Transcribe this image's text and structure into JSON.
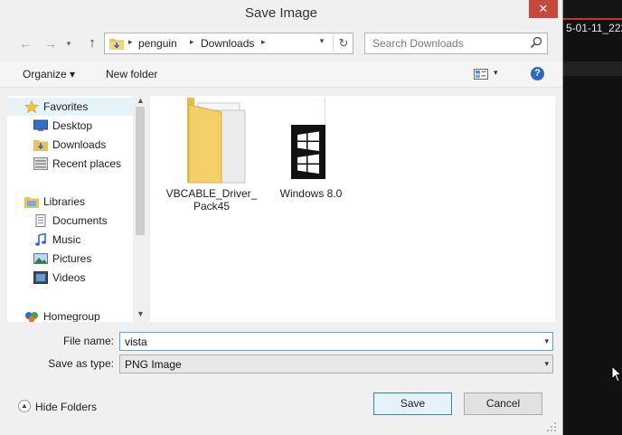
{
  "window": {
    "title": "Save Image",
    "close_glyph": "✕"
  },
  "background_app": {
    "text": "5-01-11_222"
  },
  "nav": {
    "back_glyph": "←",
    "forward_glyph": "→",
    "up_glyph": "↑",
    "breadcrumbs": [
      "penguin",
      "Downloads"
    ],
    "arrow_glyph": "▸",
    "dropdown_glyph": "▾",
    "refresh_glyph": "↻"
  },
  "search": {
    "placeholder": "Search Downloads"
  },
  "toolbar": {
    "organize_label": "Organize ▾",
    "new_folder_label": "New folder",
    "views_dropdown_glyph": "▾",
    "help_glyph": "?"
  },
  "nav_pane": {
    "favorites": {
      "label": "Favorites",
      "icon": "star-icon"
    },
    "favorite_items": [
      {
        "label": "Desktop",
        "icon": "desktop-icon"
      },
      {
        "label": "Downloads",
        "icon": "downloads-icon"
      },
      {
        "label": "Recent places",
        "icon": "recent-places-icon"
      }
    ],
    "libraries": {
      "label": "Libraries",
      "icon": "libraries-icon"
    },
    "library_items": [
      {
        "label": "Documents",
        "icon": "documents-icon"
      },
      {
        "label": "Music",
        "icon": "music-icon"
      },
      {
        "label": "Pictures",
        "icon": "pictures-icon"
      },
      {
        "label": "Videos",
        "icon": "videos-icon"
      }
    ],
    "homegroup": {
      "label": "Homegroup",
      "icon": "homegroup-icon"
    },
    "scroll_up_glyph": "▲",
    "scroll_down_glyph": "▼"
  },
  "files": [
    {
      "label_line1": "VBCABLE_Driver_",
      "label_line2": "Pack45",
      "icon": "folder-icon"
    },
    {
      "label_line1": "Windows 8.0",
      "label_line2": "",
      "icon": "windows-image-icon"
    }
  ],
  "form": {
    "file_name_label": "File name:",
    "file_name_value": "vista",
    "save_type_label": "Save as type:",
    "save_type_value": "PNG Image",
    "combo_glyph": "▾"
  },
  "footer": {
    "hide_folders_label": "Hide Folders",
    "hide_glyph": "▲",
    "save_label": "Save",
    "cancel_label": "Cancel"
  },
  "colors": {
    "accent": "#3c7fb1",
    "close": "#c7473c",
    "bg_app_accent": "#c83232"
  }
}
